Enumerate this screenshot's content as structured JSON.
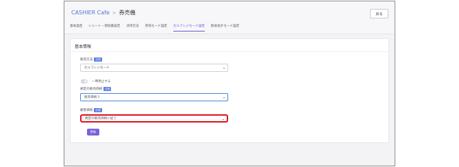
{
  "header": {
    "app_name": "CASHIER Cafe",
    "separator": ">",
    "page_title": "券売機",
    "back_label": "戻る"
  },
  "tabs": [
    {
      "label": "基本設定",
      "active": false
    },
    {
      "label": "レシート・領収書設定",
      "active": false
    },
    {
      "label": "決済方法",
      "active": false
    },
    {
      "label": "券売モード設定",
      "active": false
    },
    {
      "label": "セルフレジモード設定",
      "active": true
    },
    {
      "label": "飲食会計モード設定",
      "active": false
    }
  ],
  "card": {
    "title": "基本情報",
    "required_badge": "必須",
    "sales_method": {
      "label": "販売方法",
      "value": "セルフレジモード"
    },
    "suspend": {
      "label": "一時停止する",
      "enabled": false
    },
    "default_price": {
      "label": "規定の販売価格",
      "value": "販売価格３"
    },
    "customer_price": {
      "label": "顧客価格",
      "value": "規定の販売価格に従う"
    },
    "update_label": "更新"
  },
  "colors": {
    "accent": "#6f52c9",
    "link": "#5272d6",
    "required_badge": "#5a7de0",
    "highlight": "#e0101a",
    "button": "#7b62d8"
  }
}
